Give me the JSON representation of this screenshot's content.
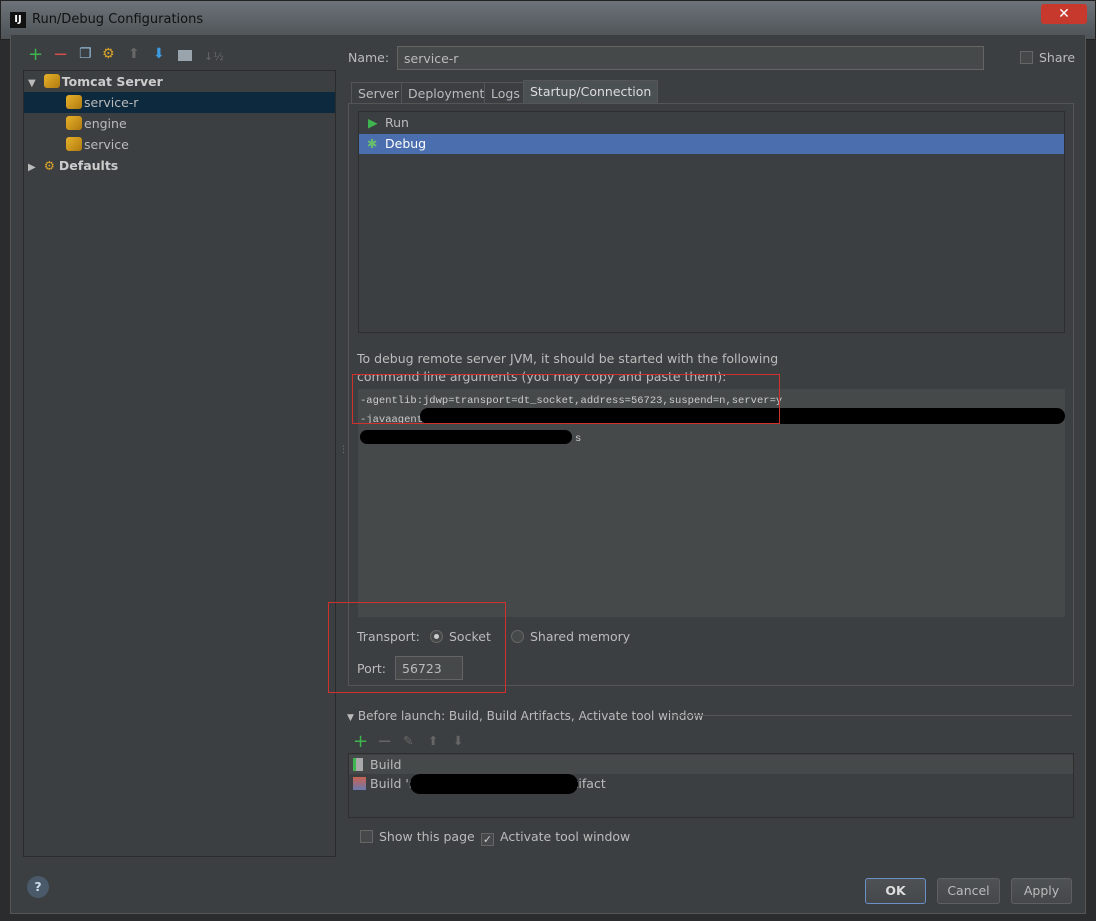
{
  "window": {
    "title": "Run/Debug Configurations",
    "logo": "IJ",
    "close": "✕"
  },
  "toolbar": {
    "icons": [
      "add-icon",
      "remove-icon",
      "copy-icon",
      "edit-defaults-icon",
      "move-up-icon",
      "move-down-icon",
      "folder-icon",
      "sort-icon"
    ]
  },
  "tree": {
    "group": "Tomcat Server",
    "items": [
      "service-r",
      "engine",
      "service"
    ],
    "defaults": "Defaults",
    "selected": "service-r"
  },
  "name": {
    "label": "Name:",
    "value": "service-r"
  },
  "share": {
    "label": "Share",
    "checked": false
  },
  "tabs": [
    "Server",
    "Deployment",
    "Logs",
    "Startup/Connection"
  ],
  "active_tab": "Startup/Connection",
  "modes": [
    "Run",
    "Debug"
  ],
  "selected_mode": "Debug",
  "hint_line1": "To debug remote server JVM, it should be started with the following",
  "hint_line2": "command line arguments (you may copy and paste them):",
  "args": {
    "line1": "-agentlib:jdwp=transport=dt_socket,address=56723,suspend=n,server=y",
    "line2": "-javaagent",
    "line3": "s"
  },
  "transport": {
    "label": "Transport:",
    "options": [
      "Socket",
      "Shared memory"
    ],
    "selected": "Socket"
  },
  "port": {
    "label": "Port:",
    "value": "56723"
  },
  "before_launch": {
    "title": "Before launch: Build, Build Artifacts, Activate tool window",
    "items": [
      "Build",
      "Build 'n",
      "artifact"
    ]
  },
  "options": {
    "show_page": {
      "label": "Show this page",
      "checked": false
    },
    "activate_tool": {
      "label": "Activate tool window",
      "checked": true
    }
  },
  "buttons": {
    "help": "?",
    "ok": "OK",
    "cancel": "Cancel",
    "apply": "Apply"
  },
  "colors": {
    "accent": "#4b6eaf",
    "highlight": "#d0312d",
    "add": "#3fb54f"
  }
}
